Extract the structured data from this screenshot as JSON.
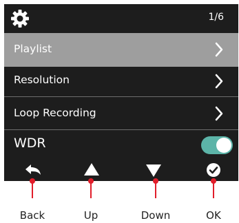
{
  "header": {
    "icon": "gear-icon",
    "page_indicator": "1/6"
  },
  "menu": {
    "items": [
      {
        "label": "Playlist",
        "selected": true,
        "icon": "chevron-right-icon"
      },
      {
        "label": "Resolution",
        "selected": false,
        "icon": "chevron-right-icon"
      },
      {
        "label": "Loop Recording",
        "selected": false,
        "icon": "chevron-right-icon"
      },
      {
        "label": "WDR",
        "toggle": true
      }
    ]
  },
  "buttons": [
    {
      "label": "Back",
      "icon": "back-arrow-icon"
    },
    {
      "label": "Up",
      "icon": "up-triangle-icon"
    },
    {
      "label": "Down",
      "icon": "down-triangle-icon"
    },
    {
      "label": "OK",
      "icon": "ok-check-icon"
    }
  ],
  "colors": {
    "screen_bg": "#1d1d1d",
    "selected_row": "#9e9e9e",
    "toggle_on": "#5cb4a8",
    "callout": "#e11d2a"
  }
}
